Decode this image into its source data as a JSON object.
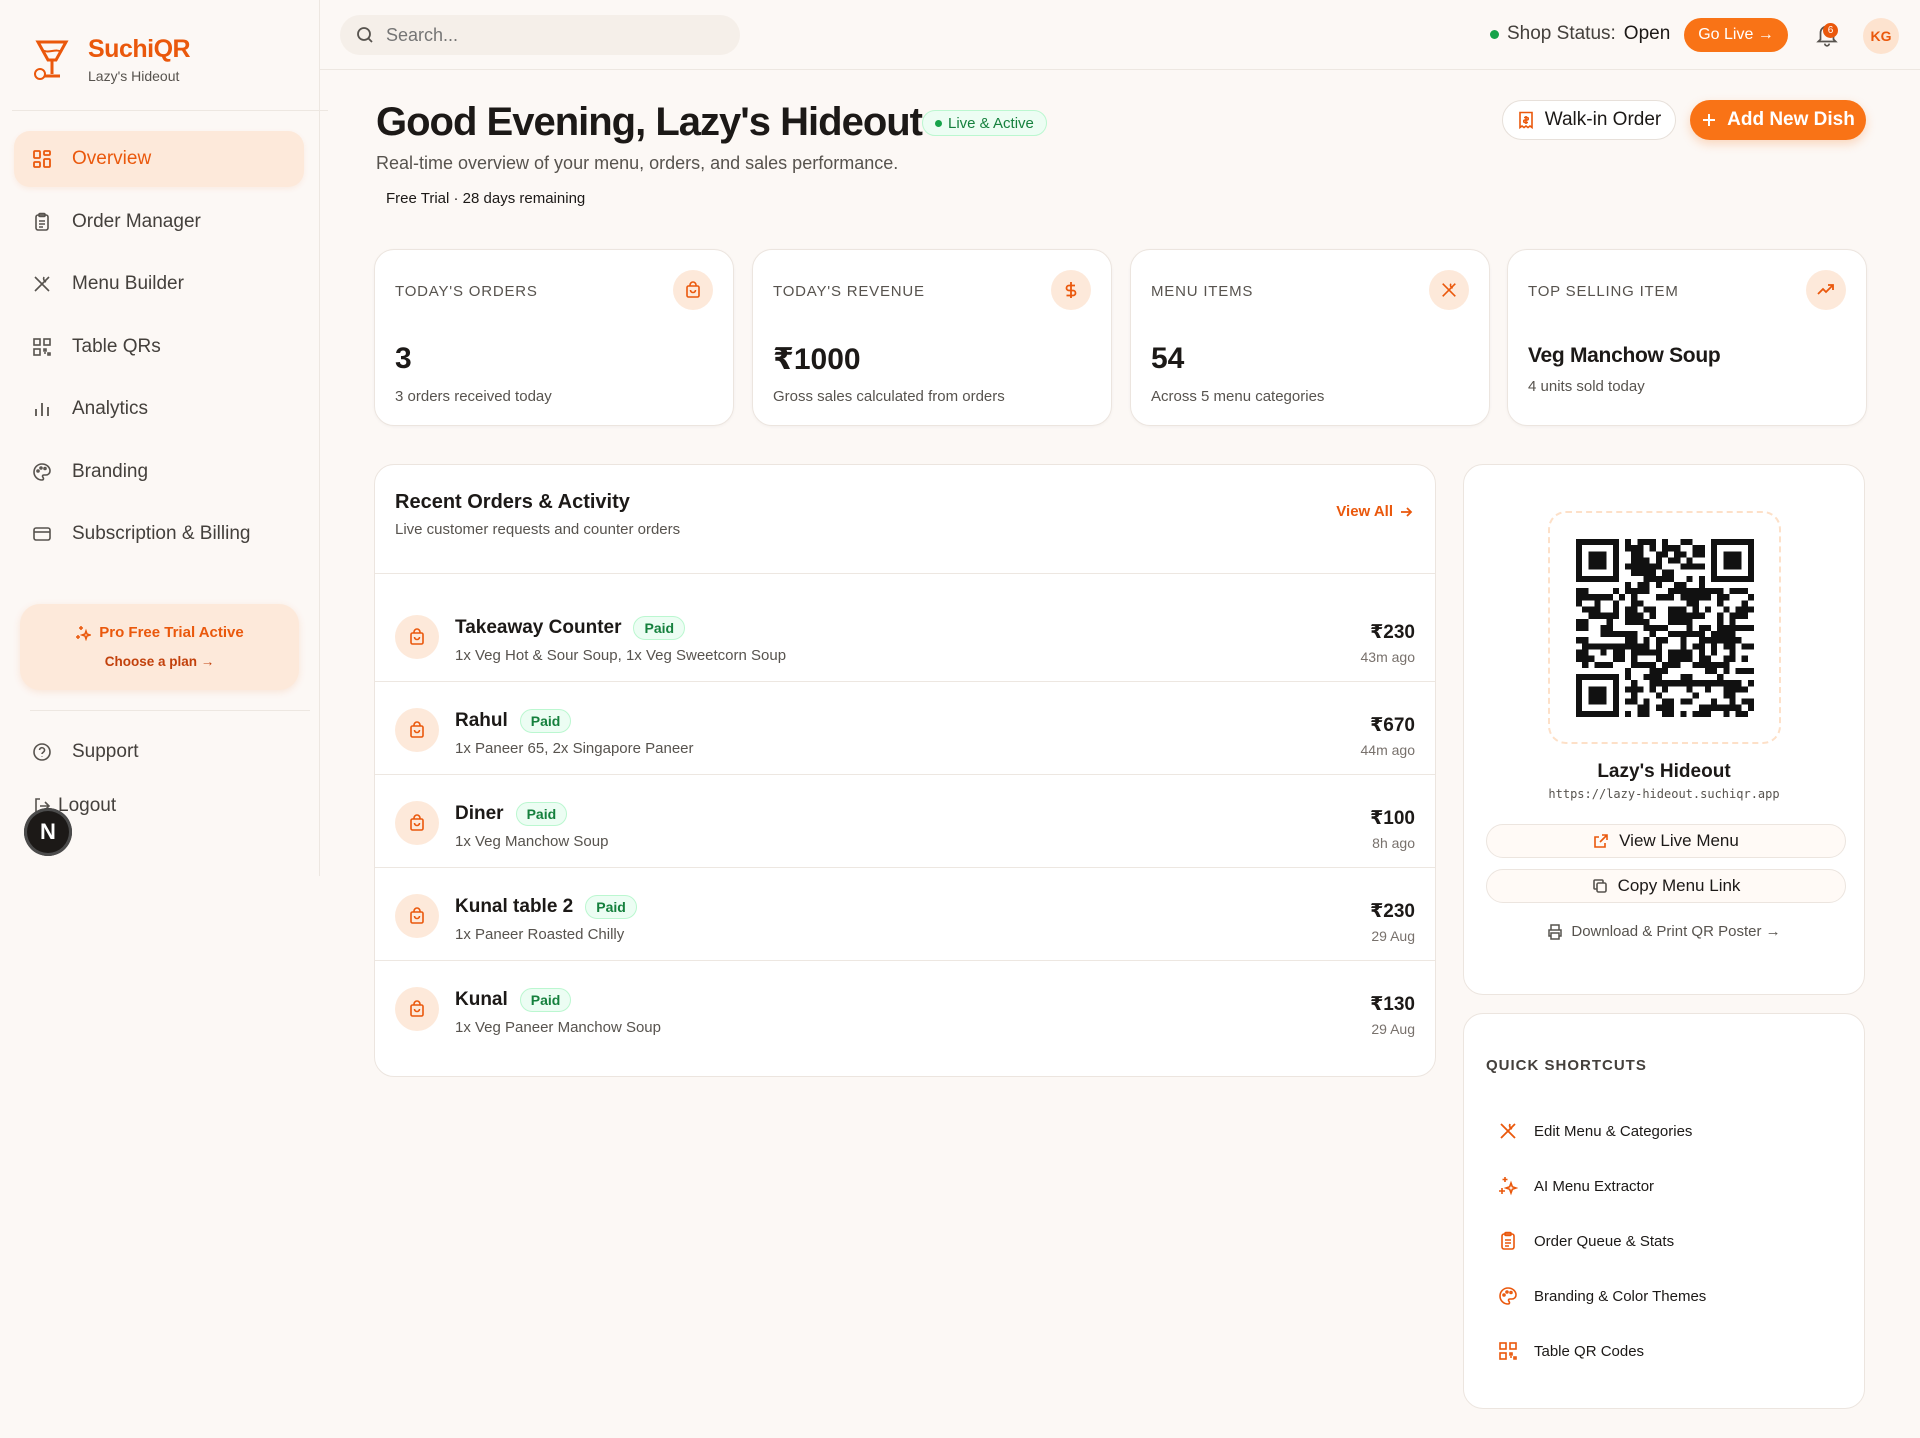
{
  "brand": {
    "name": "SuchiQR",
    "subtitle": "Lazy's Hideout"
  },
  "colors": {
    "accent": "#f97316",
    "accent_dark": "#ea580c",
    "accent_soft": "#fde9da",
    "success": "#16a34a",
    "background": "#fcf8f5"
  },
  "sidebar": {
    "items": [
      {
        "label": "Overview",
        "icon": "grid-icon",
        "active": true
      },
      {
        "label": "Order Manager",
        "icon": "clipboard-icon",
        "active": false
      },
      {
        "label": "Menu Builder",
        "icon": "utensils-icon",
        "active": false
      },
      {
        "label": "Table QRs",
        "icon": "qr-icon",
        "active": false
      },
      {
        "label": "Analytics",
        "icon": "bar-chart-icon",
        "active": false
      },
      {
        "label": "Branding",
        "icon": "palette-icon",
        "active": false
      },
      {
        "label": "Subscription & Billing",
        "icon": "credit-card-icon",
        "active": false
      }
    ],
    "trial": {
      "title": "Pro Free Trial Active",
      "link": "Choose a plan →"
    },
    "support": "Support",
    "logout": "Logout",
    "badge": "N"
  },
  "topbar": {
    "search_placeholder": "Search...",
    "shop_status_label": "Shop Status:",
    "shop_status_value": "Open",
    "go_live": "Go Live →",
    "notification_count": "6",
    "avatar_initials": "KG"
  },
  "header": {
    "greeting": "Good Evening, Lazy's Hideout",
    "live_badge": "Live & Active",
    "subtitle": "Real-time overview of your menu, orders, and sales performance.",
    "trial_note": "Free Trial · 28 days remaining",
    "walkin_button": "Walk-in Order",
    "add_button": "Add New Dish"
  },
  "stats": [
    {
      "label": "TODAY'S ORDERS",
      "value": "3",
      "desc": "3 orders received today",
      "icon": "bag-icon"
    },
    {
      "label": "TODAY'S REVENUE",
      "value": "₹1000",
      "desc": "Gross sales calculated from orders",
      "icon": "dollar-icon"
    },
    {
      "label": "MENU ITEMS",
      "value": "54",
      "desc": "Across 5 menu categories",
      "icon": "utensils-icon"
    },
    {
      "label": "TOP SELLING ITEM",
      "value": "Veg Manchow Soup",
      "desc": "4 units sold today",
      "icon": "trending-up-icon"
    }
  ],
  "orders": {
    "title": "Recent Orders & Activity",
    "subtitle": "Live customer requests and counter orders",
    "view_all": "View All",
    "rows": [
      {
        "name": "Takeaway Counter",
        "status": "Paid",
        "items": "1x Veg Hot & Sour Soup, 1x Veg Sweetcorn Soup",
        "price": "₹230",
        "time": "43m ago"
      },
      {
        "name": "Rahul",
        "status": "Paid",
        "items": "1x Paneer 65, 2x Singapore Paneer",
        "price": "₹670",
        "time": "44m ago"
      },
      {
        "name": "Diner",
        "status": "Paid",
        "items": "1x Veg Manchow Soup",
        "price": "₹100",
        "time": "8h ago"
      },
      {
        "name": "Kunal table 2",
        "status": "Paid",
        "items": "1x Paneer Roasted Chilly",
        "price": "₹230",
        "time": "29 Aug"
      },
      {
        "name": "Kunal",
        "status": "Paid",
        "items": "1x Veg Paneer Manchow Soup",
        "price": "₹130",
        "time": "29 Aug"
      }
    ]
  },
  "qr": {
    "name": "Lazy's Hideout",
    "url": "https://lazy-hideout.suchiqr.app",
    "view_live": "View Live Menu",
    "copy_link": "Copy Menu Link",
    "download": "Download & Print QR Poster →"
  },
  "shortcuts": {
    "title": "QUICK SHORTCUTS",
    "items": [
      {
        "label": "Edit Menu & Categories",
        "icon": "utensils-icon"
      },
      {
        "label": "AI Menu Extractor",
        "icon": "sparkles-icon"
      },
      {
        "label": "Order Queue & Stats",
        "icon": "clipboard-icon"
      },
      {
        "label": "Branding & Color Themes",
        "icon": "palette-icon"
      },
      {
        "label": "Table QR Codes",
        "icon": "qr-icon"
      }
    ]
  }
}
